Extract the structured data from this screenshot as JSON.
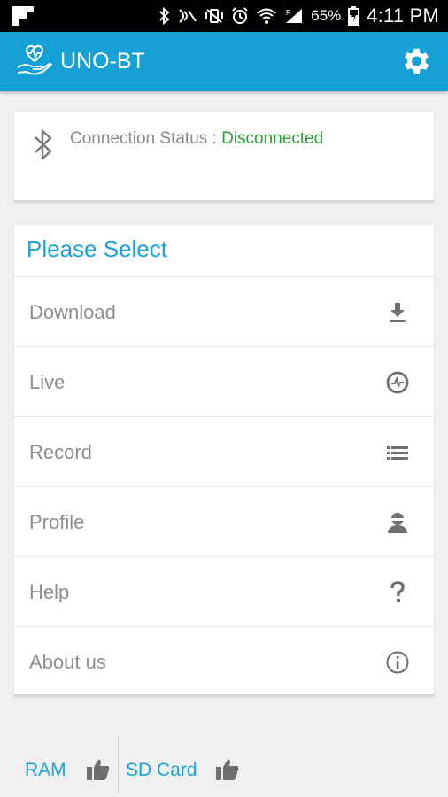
{
  "status_bar": {
    "battery_percent": "65%",
    "time": "4:11 PM"
  },
  "app_bar": {
    "title": "UNO-BT"
  },
  "connection": {
    "label": "Connection Status : ",
    "value": "Disconnected",
    "value_color": "#2aa334"
  },
  "menu": {
    "header": "Please Select",
    "items": [
      {
        "label": "Download",
        "icon": "download-icon"
      },
      {
        "label": "Live",
        "icon": "heartbeat-icon"
      },
      {
        "label": "Record",
        "icon": "list-icon"
      },
      {
        "label": "Profile",
        "icon": "person-icon"
      },
      {
        "label": "Help",
        "icon": "question-icon"
      },
      {
        "label": "About us",
        "icon": "info-icon"
      }
    ]
  },
  "bottom": {
    "ram_label": "RAM",
    "sd_label": "SD Card"
  },
  "colors": {
    "accent": "#15a0d6",
    "text_secondary": "#8e8e8e",
    "status_bar": "#000000"
  }
}
